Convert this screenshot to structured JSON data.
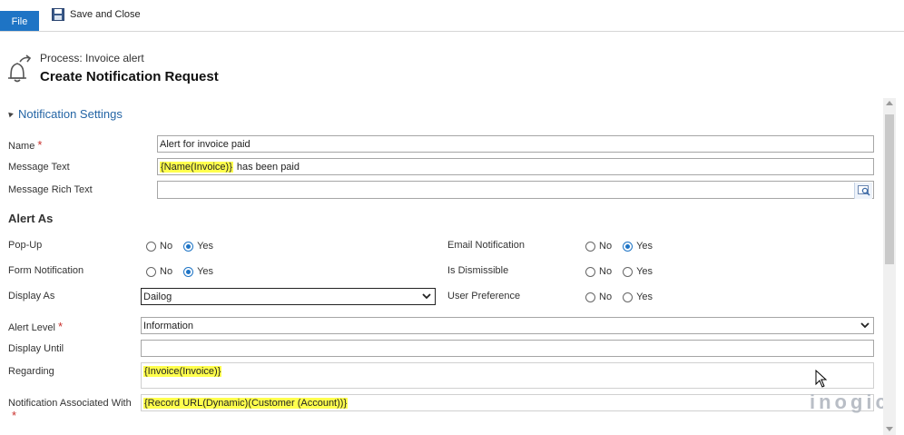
{
  "toolbar": {
    "file_label": "File",
    "save_close_label": "Save and Close"
  },
  "header": {
    "process": "Process: Invoice alert",
    "title": "Create Notification Request"
  },
  "section": {
    "title": "Notification Settings"
  },
  "fields": {
    "name": {
      "label": "Name",
      "value": "Alert for invoice paid"
    },
    "message_text": {
      "label": "Message Text",
      "token": "{Name(Invoice)}",
      "suffix": "has been paid"
    },
    "message_rich_text": {
      "label": "Message Rich Text",
      "value": ""
    }
  },
  "alert_as": {
    "title": "Alert As",
    "popup": {
      "label": "Pop-Up",
      "no": "No",
      "yes": "Yes",
      "selected": "Yes"
    },
    "form_notification": {
      "label": "Form Notification",
      "no": "No",
      "yes": "Yes",
      "selected": "Yes"
    },
    "display_as": {
      "label": "Display As",
      "value": "Dailog"
    },
    "email_notification": {
      "label": "Email Notification",
      "no": "No",
      "yes": "Yes",
      "selected": "Yes"
    },
    "is_dismissible": {
      "label": "Is Dismissible",
      "no": "No",
      "yes": "Yes",
      "selected": ""
    },
    "user_preference": {
      "label": "User Preference",
      "no": "No",
      "yes": "Yes",
      "selected": ""
    }
  },
  "alert_level": {
    "label": "Alert Level",
    "value": "Information"
  },
  "display_until": {
    "label": "Display Until",
    "value": ""
  },
  "regarding": {
    "label": "Regarding",
    "token": "{Invoice(Invoice)}"
  },
  "notification_associated": {
    "label": "Notification Associated With",
    "token": "{Record URL(Dynamic)(Customer (Account))}"
  },
  "required_mark": "*",
  "watermark": "inogic",
  "colors": {
    "accent": "#1e74c5",
    "section": "#2465a5",
    "highlight": "#ffff4d",
    "required": "#c9302c"
  }
}
